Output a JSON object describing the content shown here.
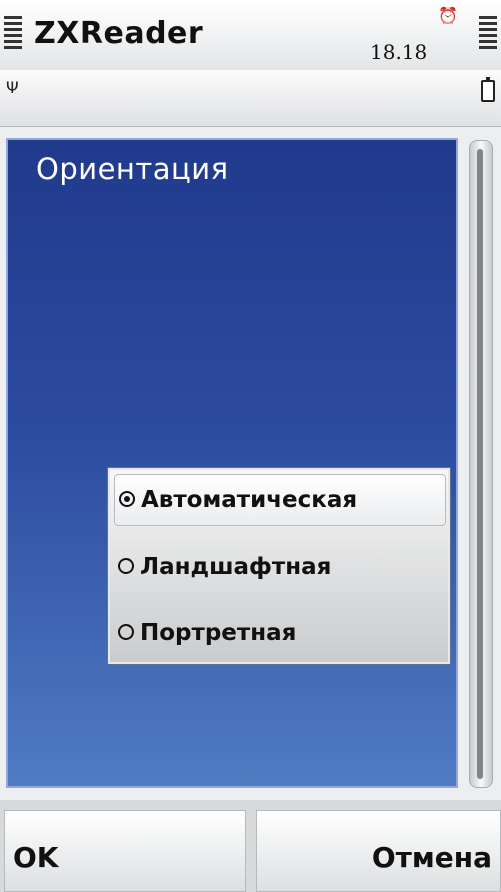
{
  "status_bar": {
    "app_title": "ZXReader",
    "time": "18.18"
  },
  "dialog": {
    "title": "Ориентация",
    "options": [
      {
        "label": "Автоматическая",
        "selected": true
      },
      {
        "label": "Ландшафтная",
        "selected": false
      },
      {
        "label": "Портретная",
        "selected": false
      }
    ]
  },
  "softkeys": {
    "left": "OK",
    "right": "Отмена"
  },
  "colors": {
    "panel_top": "#203a8c",
    "panel_bottom": "#4f7cc2",
    "title_text": "#ffffff"
  },
  "icons": [
    "signal-bars-icon",
    "clock-icon",
    "antenna-icon",
    "battery-icon",
    "radio-selected-icon",
    "radio-unselected-icon"
  ]
}
